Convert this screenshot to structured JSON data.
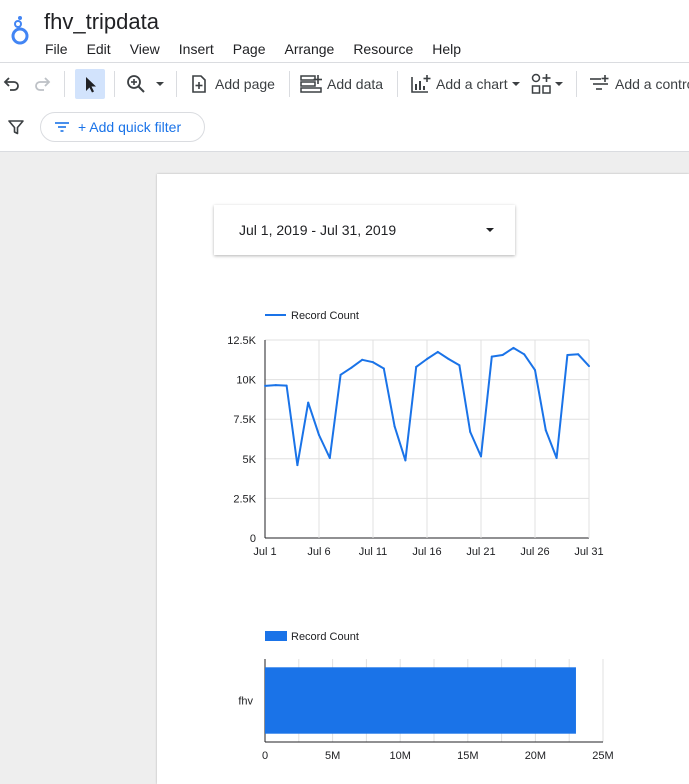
{
  "app": {
    "doc_title": "fhv_tripdata",
    "menu": [
      "File",
      "Edit",
      "View",
      "Insert",
      "Page",
      "Arrange",
      "Resource",
      "Help"
    ]
  },
  "toolbar": {
    "add_page": "Add page",
    "add_data": "Add data",
    "add_chart": "Add a chart",
    "add_control": "Add a contro"
  },
  "filterbar": {
    "quick_filter": "+ Add quick filter"
  },
  "date_range": {
    "value": "Jul 1, 2019 - Jul 31, 2019"
  },
  "colors": {
    "accent": "#1a73e8",
    "series": "#1a73e8",
    "selected_tool_bg": "#d2e3fc",
    "canvas_bg": "#eeeeee"
  },
  "chart_data": [
    {
      "type": "line",
      "legend": "Record Count",
      "legend_position": "top-left",
      "x": [
        "Jul 1",
        "Jul 2",
        "Jul 3",
        "Jul 4",
        "Jul 5",
        "Jul 6",
        "Jul 7",
        "Jul 8",
        "Jul 9",
        "Jul 10",
        "Jul 11",
        "Jul 12",
        "Jul 13",
        "Jul 14",
        "Jul 15",
        "Jul 16",
        "Jul 17",
        "Jul 18",
        "Jul 19",
        "Jul 20",
        "Jul 21",
        "Jul 22",
        "Jul 23",
        "Jul 24",
        "Jul 25",
        "Jul 26",
        "Jul 27",
        "Jul 28",
        "Jul 29",
        "Jul 30",
        "Jul 31"
      ],
      "x_tick_labels": [
        "Jul 1",
        "Jul 6",
        "Jul 11",
        "Jul 16",
        "Jul 21",
        "Jul 26",
        "Jul 31"
      ],
      "y_tick_labels": [
        "0",
        "2.5K",
        "5K",
        "7.5K",
        "10K",
        "12.5K"
      ],
      "ylim": [
        0,
        12500
      ],
      "grid": true,
      "series": [
        {
          "name": "Record Count",
          "values": [
            9600,
            9650,
            9620,
            4600,
            8550,
            6500,
            5050,
            10300,
            10750,
            11250,
            11100,
            10700,
            7050,
            4900,
            10800,
            11300,
            11750,
            11300,
            10900,
            6700,
            5150,
            11450,
            11550,
            12000,
            11600,
            10600,
            6800,
            5050,
            11550,
            11600,
            10850
          ]
        }
      ]
    },
    {
      "type": "bar",
      "orientation": "horizontal",
      "legend": "Record Count",
      "legend_position": "top-left",
      "categories": [
        "fhv"
      ],
      "x_tick_labels": [
        "0",
        "5M",
        "10M",
        "15M",
        "20M",
        "25M"
      ],
      "xlim": [
        0,
        25000000
      ],
      "grid": true,
      "series": [
        {
          "name": "Record Count",
          "values": [
            23000000
          ]
        }
      ]
    }
  ]
}
